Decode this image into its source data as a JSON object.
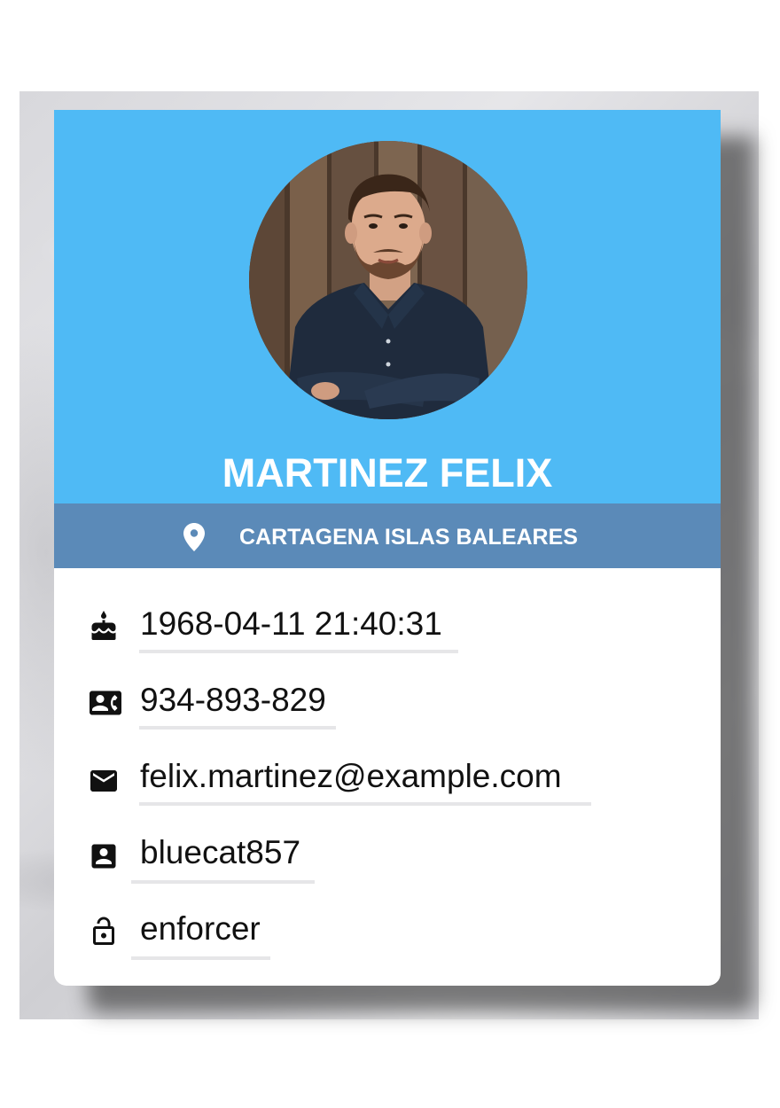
{
  "profile": {
    "name": "MARTINEZ FELIX",
    "location": "CARTAGENA ISLAS BALEARES",
    "header_color": "#4fbaf5",
    "location_bar_color": "#5b8ab8"
  },
  "details": {
    "birthdate": {
      "value": "1968-04-11 21:40:31",
      "icon": "cake-icon"
    },
    "phone": {
      "value": "934-893-829",
      "icon": "contact-phone-icon"
    },
    "email": {
      "value": "felix.martinez@example.com",
      "icon": "mail-icon"
    },
    "username": {
      "value": "bluecat857",
      "icon": "account-box-icon"
    },
    "password": {
      "value": "enforcer",
      "icon": "lock-open-icon"
    }
  }
}
